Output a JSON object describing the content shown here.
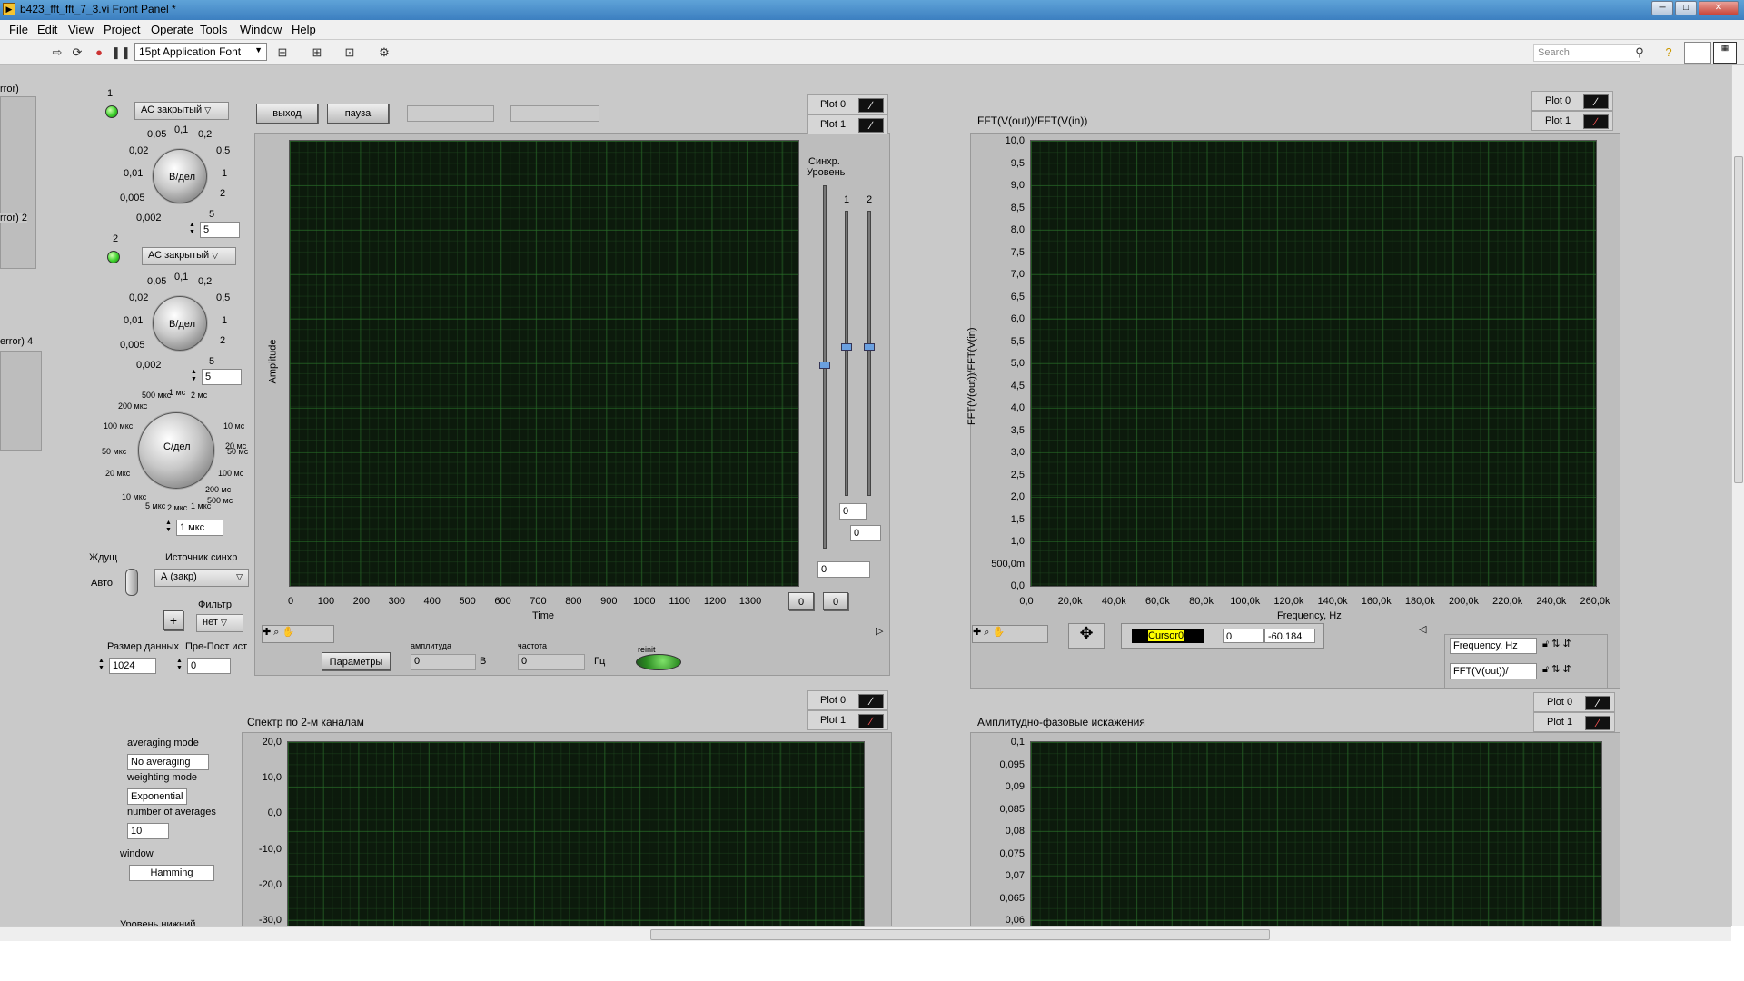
{
  "window": {
    "title": "b423_fft_fft_7_3.vi Front Panel *"
  },
  "menu": [
    "File",
    "Edit",
    "View",
    "Project",
    "Operate",
    "Tools",
    "Window",
    "Help"
  ],
  "toolbar": {
    "font": "15pt Application Font",
    "search_placeholder": "Search"
  },
  "left_clusters": [
    "rror)",
    "rror) 2",
    "error) 4"
  ],
  "ch1": {
    "num": "1",
    "coupling": "АС закрытый",
    "knob_label": "В/дел",
    "value": "5",
    "ticks": [
      "0,05",
      "0,1",
      "0,2",
      "0,02",
      "0,5",
      "0,01",
      "1",
      "0,005",
      "2",
      "0,002",
      "5"
    ]
  },
  "ch2": {
    "num": "2",
    "coupling": "АС закрытый",
    "knob_label": "В/дел",
    "value": "5",
    "ticks": [
      "0,05",
      "0,1",
      "0,2",
      "0,02",
      "0,5",
      "0,01",
      "1",
      "0,005",
      "2",
      "0,002",
      "5"
    ]
  },
  "timebase": {
    "knob_label": "С/дел",
    "value": "1 мкс",
    "ticks": [
      "500 мкс",
      "1 мс",
      "2 мс",
      "200 мкс",
      "10 мс",
      "100 мкс",
      "20 мс",
      "50 мкс",
      "50 мс",
      "20 мкс",
      "100 мс",
      "10 мкс",
      "200 мс",
      "500 мс",
      "5 мкс",
      "2 мкс",
      "1 мкс"
    ]
  },
  "trigger": {
    "mode_label": "Ждущ",
    "mode_value": "Авто",
    "source_label": "Источник синхр",
    "source_value": "А (закр)",
    "filter_label": "Фильтр",
    "filter_value": "нет",
    "plus": "+"
  },
  "data": {
    "size_label": "Размер данных",
    "size_value": "1024",
    "prepost_label": "Пре-Пост ист",
    "prepost_value": "0"
  },
  "buttons": {
    "exit": "выход",
    "pause": "пауза",
    "params": "Параметры"
  },
  "amp": {
    "label": "амплитуда",
    "value": "0",
    "unit": "В"
  },
  "freq": {
    "label": "частота",
    "value": "0",
    "unit": "Гц"
  },
  "reinit": {
    "label": "reinit"
  },
  "time_graph": {
    "ylabel": "Amplitude",
    "xlabel": "Time",
    "xticks": [
      "0",
      "100",
      "200",
      "300",
      "400",
      "500",
      "600",
      "700",
      "800",
      "900",
      "1000",
      "1100",
      "1200",
      "1300"
    ],
    "legend": [
      "Plot 0",
      "Plot 1"
    ],
    "cursor_a": "0",
    "cursor_b": "0"
  },
  "sync": {
    "label1": "Синхр.",
    "label2": "Уровень",
    "ch1": "1",
    "ch2": "2",
    "val_a": "0",
    "val_b": "0",
    "val_c": "0"
  },
  "fft_graph": {
    "title": "FFT(V(out))/FFT(V(in))",
    "ylabel": "FFT(V(out))/FFT(V(in)",
    "xlabel": "Frequency, Hz",
    "yticks": [
      "10,0",
      "9,5",
      "9,0",
      "8,5",
      "8,0",
      "7,5",
      "7,0",
      "6,5",
      "6,0",
      "5,5",
      "5,0",
      "4,5",
      "4,0",
      "3,5",
      "3,0",
      "2,5",
      "2,0",
      "1,5",
      "1,0",
      "500,0m",
      "0,0"
    ],
    "xticks": [
      "0,0",
      "20,0k",
      "40,0k",
      "60,0k",
      "80,0k",
      "100,0k",
      "120,0k",
      "140,0k",
      "160,0k",
      "180,0k",
      "200,0k",
      "220,0k",
      "240,0k",
      "260,0k"
    ],
    "legend": [
      "Plot 0",
      "Plot 1"
    ],
    "cursor_name": "Cursor0",
    "cursor_x": "0",
    "cursor_y": "-60.184",
    "scale_x": "Frequency, Hz",
    "scale_y": "FFT(V(out))/"
  },
  "spectrum": {
    "title": "Спектр по 2-м каналам",
    "yticks": [
      "20,0",
      "10,0",
      "0,0",
      "-10,0",
      "-20,0",
      "-30,0"
    ],
    "legend": [
      "Plot 0",
      "Plot 1"
    ]
  },
  "averaging": {
    "mode_label": "averaging mode",
    "mode_value": "No averaging",
    "weight_label": "weighting mode",
    "weight_value": "Exponential",
    "num_label": "number of averages",
    "num_value": "10",
    "window_label": "window",
    "window_value": "Hamming",
    "cut": "Уровень нижний"
  },
  "afc": {
    "title": "Амплитудно-фазовые искажения",
    "yticks": [
      "0,1",
      "0,095",
      "0,09",
      "0,085",
      "0,08",
      "0,075",
      "0,07",
      "0,065",
      "0,06"
    ],
    "legend": [
      "Plot 0",
      "Plot 1"
    ]
  },
  "colors": {
    "plot_bg": "#0c1a0c",
    "grid": "#2a6e2a",
    "panel": "#c9c9c9",
    "led": "#3cd12c",
    "cursor": "#ffff00"
  }
}
